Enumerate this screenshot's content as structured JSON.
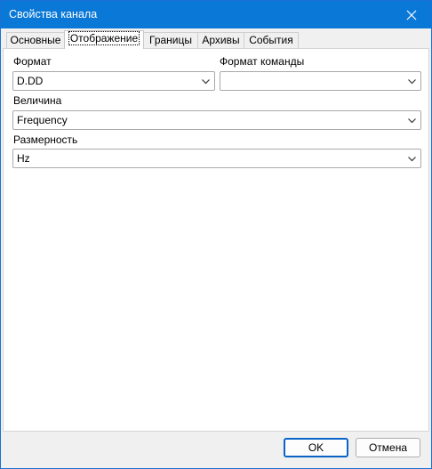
{
  "window": {
    "title": "Свойства канала"
  },
  "tabs": [
    {
      "label": "Основные"
    },
    {
      "label": "Отображение",
      "active": true
    },
    {
      "label": "Границы"
    },
    {
      "label": "Архивы"
    },
    {
      "label": "События"
    }
  ],
  "form": {
    "format_label": "Формат",
    "format_value": "D.DD",
    "command_format_label": "Формат команды",
    "command_format_value": "",
    "quantity_label": "Величина",
    "quantity_value": "Frequency",
    "unit_label": "Размерность",
    "unit_value": "Hz"
  },
  "footer": {
    "ok_label": "OK",
    "cancel_label": "Отмена"
  },
  "colors": {
    "titlebar": "#0a78d7",
    "default_button_border": "#0a64c8"
  },
  "icons": {
    "close": "close-icon",
    "dropdown": "chevron-down-icon"
  }
}
